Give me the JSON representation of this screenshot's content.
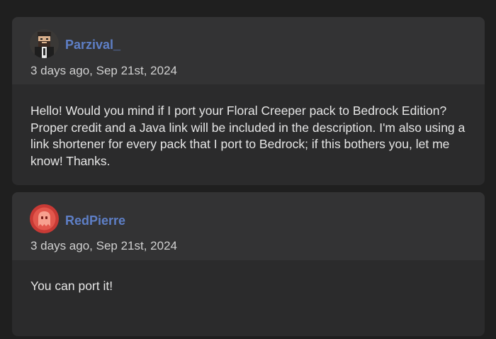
{
  "comments": [
    {
      "avatar_icon": "pixel-bearded-man-avatar-icon",
      "username": "Parzival_",
      "timestamp": "3 days ago, Sep 21st, 2024",
      "body": "Hello! Would you mind if I port your Floral Creeper pack to Bedrock Edition? Proper credit and a Java link will be included in the description. I'm also using a link shortener for every pack that I port to Bedrock; if this bothers you, let me know! Thanks."
    },
    {
      "avatar_icon": "red-ghost-avatar-icon",
      "username": "RedPierre",
      "timestamp": "3 days ago, Sep 21st, 2024",
      "body": "You can port it!"
    }
  ],
  "colors": {
    "page_background": "#1f1f1f",
    "card_background": "#2b2b2c",
    "card_header_background": "#333334",
    "username": "#5e7fc6",
    "text": "#e6e6e6"
  }
}
